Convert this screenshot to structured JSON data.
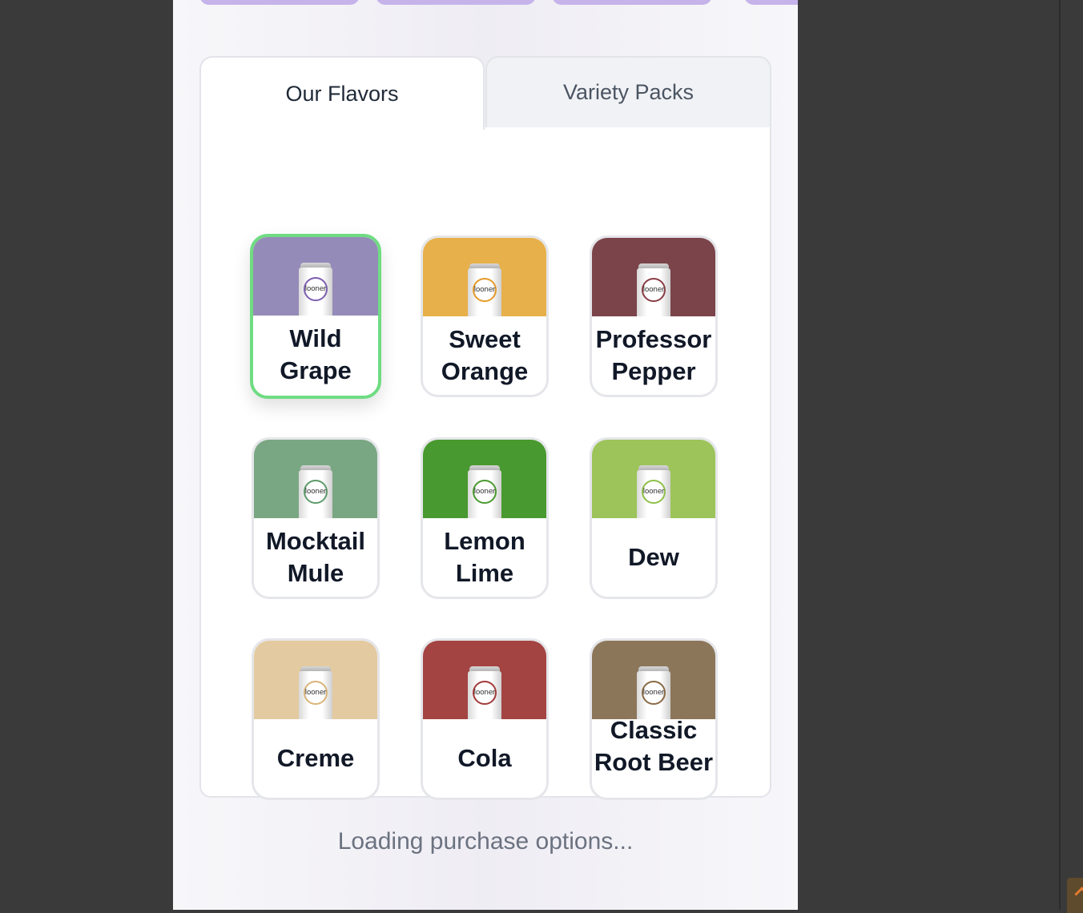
{
  "tabs": [
    {
      "label": "Our Flavors",
      "active": true
    },
    {
      "label": "Variety Packs",
      "active": false
    }
  ],
  "flavors": [
    {
      "name": "Wild Grape",
      "color": "#958bb8",
      "ring": "#7d5fb0",
      "selected": true
    },
    {
      "name": "Sweet Orange",
      "color": "#e7b04a",
      "ring": "#e59a2a",
      "selected": false
    },
    {
      "name": "Professor Pepper",
      "color": "#7a444a",
      "ring": "#8a3d45",
      "selected": false
    },
    {
      "name": "Mocktail Mule",
      "color": "#7aa783",
      "ring": "#5e9a6a",
      "selected": false
    },
    {
      "name": "Lemon Lime",
      "color": "#48992f",
      "ring": "#4a9a30",
      "selected": false
    },
    {
      "name": "Dew",
      "color": "#9cc45a",
      "ring": "#8fc04a",
      "selected": false
    },
    {
      "name": "Creme",
      "color": "#e3caa0",
      "ring": "#d9b47a",
      "selected": false
    },
    {
      "name": "Cola",
      "color": "#a34442",
      "ring": "#a33a3a",
      "selected": false
    },
    {
      "name": "Classic Root Beer",
      "color": "#8c765a",
      "ring": "#8a6a45",
      "selected": false
    }
  ],
  "can_brand": "looner",
  "status": {
    "loading_text": "Loading purchase options..."
  },
  "colors": {
    "accent_pill": "#c5b3ea",
    "selected_border": "#6fdc82"
  }
}
